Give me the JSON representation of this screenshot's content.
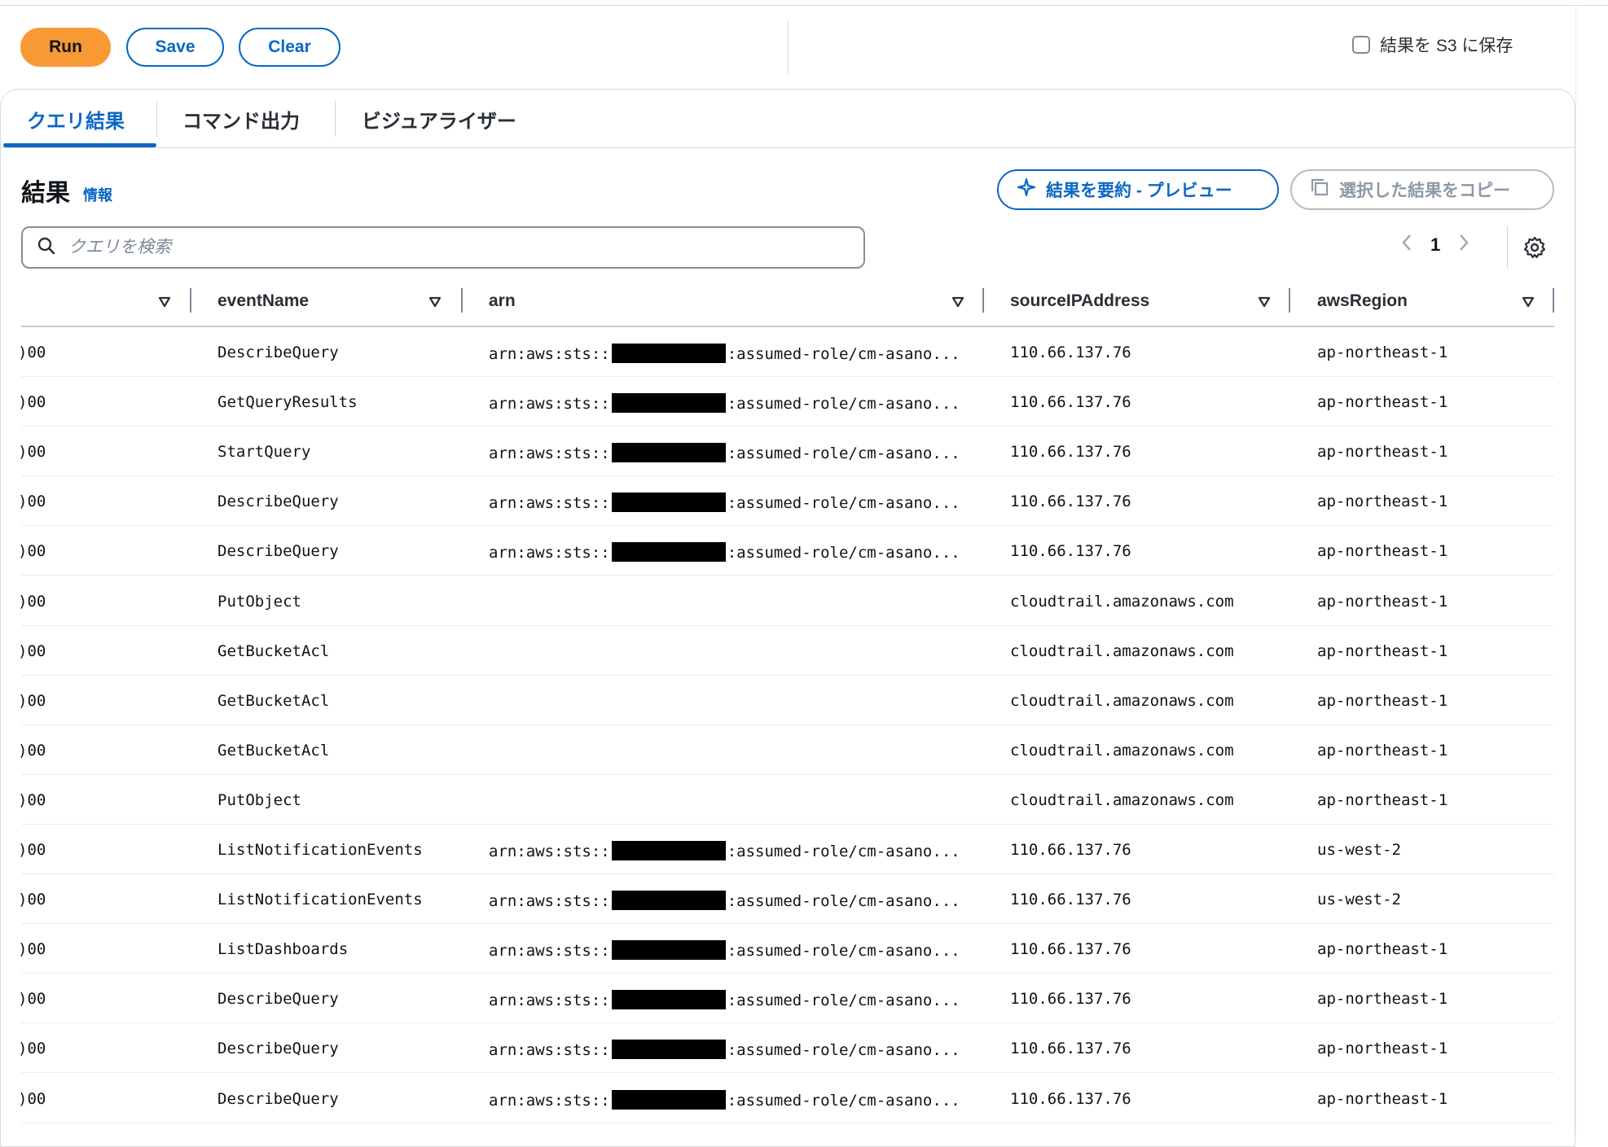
{
  "toolbar": {
    "run_label": "Run",
    "save_label": "Save",
    "clear_label": "Clear",
    "s3_label": "結果を S3 に保存"
  },
  "tabs": [
    {
      "label": "クエリ結果",
      "active": true
    },
    {
      "label": "コマンド出力",
      "active": false
    },
    {
      "label": "ビジュアライザー",
      "active": false
    }
  ],
  "results": {
    "title": "結果",
    "info": "情報",
    "summarize_label": "結果を要約 - プレビュー",
    "copy_label": "選択した結果をコピー"
  },
  "search": {
    "placeholder": "クエリを検索",
    "value": ""
  },
  "pager": {
    "page": "1"
  },
  "table": {
    "columns": [
      "",
      "eventName",
      "arn",
      "sourceIPAddress",
      "awsRegion"
    ],
    "arn_prefix": "arn:aws:sts::",
    "arn_suffix": ":assumed-role/cm-asano...",
    "rows": [
      {
        "c0": ")00",
        "eventName": "DescribeQuery",
        "has_arn": true,
        "sourceIPAddress": "110.66.137.76",
        "awsRegion": "ap-northeast-1"
      },
      {
        "c0": ")00",
        "eventName": "GetQueryResults",
        "has_arn": true,
        "sourceIPAddress": "110.66.137.76",
        "awsRegion": "ap-northeast-1"
      },
      {
        "c0": ")00",
        "eventName": "StartQuery",
        "has_arn": true,
        "sourceIPAddress": "110.66.137.76",
        "awsRegion": "ap-northeast-1"
      },
      {
        "c0": ")00",
        "eventName": "DescribeQuery",
        "has_arn": true,
        "sourceIPAddress": "110.66.137.76",
        "awsRegion": "ap-northeast-1"
      },
      {
        "c0": ")00",
        "eventName": "DescribeQuery",
        "has_arn": true,
        "sourceIPAddress": "110.66.137.76",
        "awsRegion": "ap-northeast-1"
      },
      {
        "c0": ")00",
        "eventName": "PutObject",
        "has_arn": false,
        "sourceIPAddress": "cloudtrail.amazonaws.com",
        "awsRegion": "ap-northeast-1"
      },
      {
        "c0": ")00",
        "eventName": "GetBucketAcl",
        "has_arn": false,
        "sourceIPAddress": "cloudtrail.amazonaws.com",
        "awsRegion": "ap-northeast-1"
      },
      {
        "c0": ")00",
        "eventName": "GetBucketAcl",
        "has_arn": false,
        "sourceIPAddress": "cloudtrail.amazonaws.com",
        "awsRegion": "ap-northeast-1"
      },
      {
        "c0": ")00",
        "eventName": "GetBucketAcl",
        "has_arn": false,
        "sourceIPAddress": "cloudtrail.amazonaws.com",
        "awsRegion": "ap-northeast-1"
      },
      {
        "c0": ")00",
        "eventName": "PutObject",
        "has_arn": false,
        "sourceIPAddress": "cloudtrail.amazonaws.com",
        "awsRegion": "ap-northeast-1"
      },
      {
        "c0": ")00",
        "eventName": "ListNotificationEvents",
        "has_arn": true,
        "sourceIPAddress": "110.66.137.76",
        "awsRegion": "us-west-2"
      },
      {
        "c0": ")00",
        "eventName": "ListNotificationEvents",
        "has_arn": true,
        "sourceIPAddress": "110.66.137.76",
        "awsRegion": "us-west-2"
      },
      {
        "c0": ")00",
        "eventName": "ListDashboards",
        "has_arn": true,
        "sourceIPAddress": "110.66.137.76",
        "awsRegion": "ap-northeast-1"
      },
      {
        "c0": ")00",
        "eventName": "DescribeQuery",
        "has_arn": true,
        "sourceIPAddress": "110.66.137.76",
        "awsRegion": "ap-northeast-1"
      },
      {
        "c0": ")00",
        "eventName": "DescribeQuery",
        "has_arn": true,
        "sourceIPAddress": "110.66.137.76",
        "awsRegion": "ap-northeast-1"
      },
      {
        "c0": ")00",
        "eventName": "DescribeQuery",
        "has_arn": true,
        "sourceIPAddress": "110.66.137.76",
        "awsRegion": "ap-northeast-1"
      }
    ]
  },
  "colors": {
    "accent": "#0b67c4",
    "run_button": "#f79a35",
    "text": "#0f141a",
    "border": "#d5dbdb"
  },
  "icons": [
    "search-icon",
    "sparkle-icon",
    "copy-icon",
    "chevron-left-icon",
    "chevron-right-icon",
    "gear-icon",
    "sort-down-icon"
  ]
}
